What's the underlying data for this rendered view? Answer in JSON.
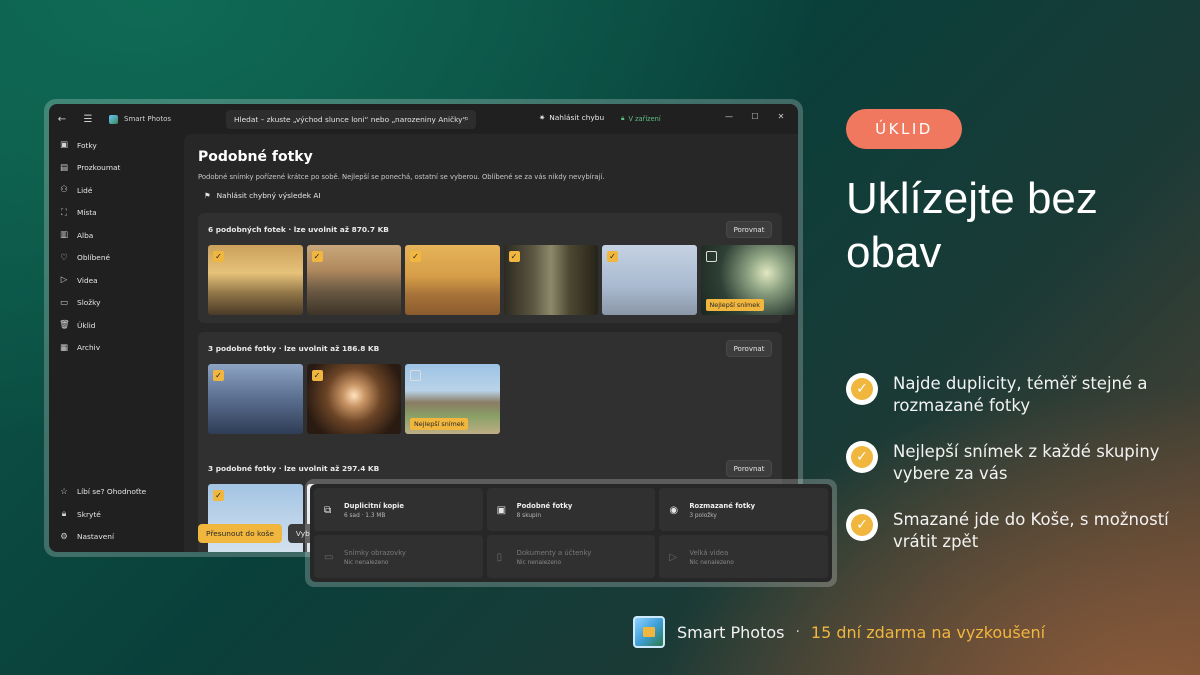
{
  "titlebar": {
    "app_name": "Smart Photos",
    "search_placeholder": "Hledat – zkuste „východ slunce loni“ nebo „narozeniny Aničky“",
    "report_bug": "Nahlásit chybu",
    "on_device": "V zařízení"
  },
  "sidebar": {
    "items": [
      "Fotky",
      "Prozkoumat",
      "Lidé",
      "Místa",
      "Alba",
      "Oblíbené",
      "Videa",
      "Složky",
      "Úklid",
      "Archiv"
    ],
    "bottom_items": [
      "Líbí se? Ohodnoťte",
      "Skryté",
      "Nastavení"
    ]
  },
  "main": {
    "title": "Podobné fotky",
    "subtitle": "Podobné snímky pořízené krátce po sobě. Nejlepší se ponechá, ostatní se vyberou. Oblíbené se za vás nikdy nevybírají.",
    "report_ai": "Nahlásit chybný výsledek AI",
    "compare_label": "Porovnat",
    "best_label": "Nejlepší snímek",
    "groups": [
      {
        "title": "6 podobných fotek · lze uvolnit až 870.7 KB"
      },
      {
        "title": "3 podobné fotky · lze uvolnit až 186.8 KB"
      },
      {
        "title": "3 podobné fotky · lze uvolnit až 297.4 KB"
      }
    ],
    "move_to_trash": "Přesunout do koše",
    "select_label": "Vybrat"
  },
  "categories": [
    {
      "name": "Duplicitní kopie",
      "sub": "6 sad · 1.3 MB",
      "icon": "copy-icon",
      "active": true
    },
    {
      "name": "Podobné fotky",
      "sub": "8 skupin",
      "icon": "photos-icon",
      "active": true
    },
    {
      "name": "Rozmazané fotky",
      "sub": "3 položky",
      "icon": "eye-icon",
      "active": true
    },
    {
      "name": "Snímky obrazovky",
      "sub": "Nic nenalezeno",
      "icon": "monitor-icon",
      "active": false
    },
    {
      "name": "Dokumenty a účtenky",
      "sub": "Nic nenalezeno",
      "icon": "document-icon",
      "active": false
    },
    {
      "name": "Velká videa",
      "sub": "Nic nenalezeno",
      "icon": "video-icon",
      "active": false
    }
  ],
  "marketing": {
    "badge": "ÚKLID",
    "headline": "Uklízejte bez obav",
    "features": [
      "Najde duplicity, téměř stejné a rozmazané fotky",
      "Nejlepší snímek z každé skupiny vybere za vás",
      "Smazané jde do Koše, s možností vrátit zpět"
    ],
    "footer_name": "Smart Photos",
    "footer_separator": "·",
    "footer_trial": "15 dní zdarma na vyzkoušení"
  },
  "colors": {
    "accent": "#f0b63e",
    "badge": "#f0785f",
    "window_bg": "#202020",
    "device_green": "#5fbf85"
  }
}
